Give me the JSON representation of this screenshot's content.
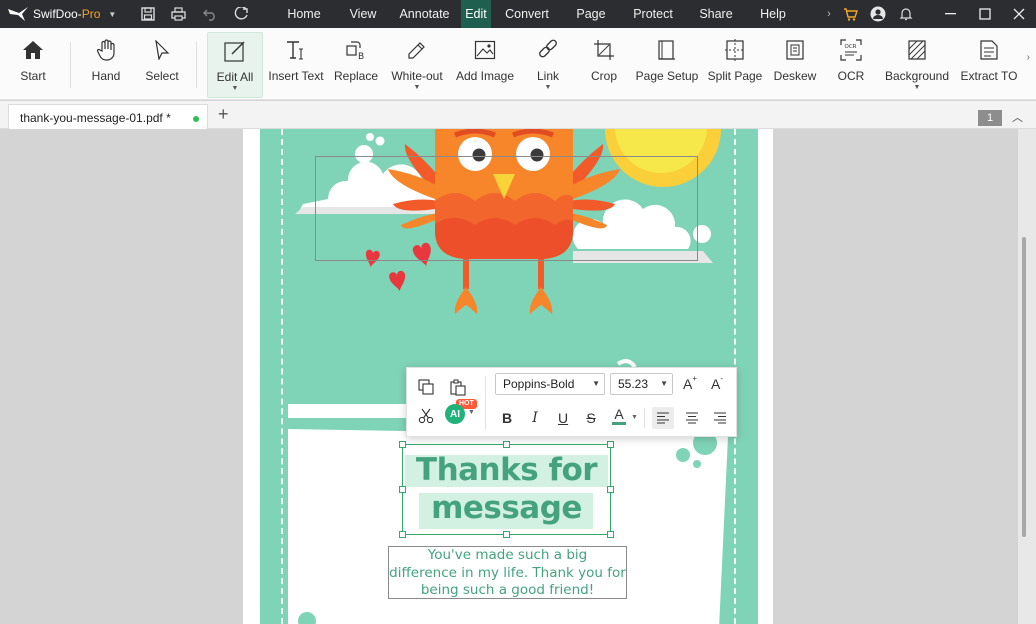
{
  "app": {
    "brand": "SwifDoo-",
    "brand_suffix": "Pro"
  },
  "menu": {
    "items": [
      {
        "label": "Home"
      },
      {
        "label": "View"
      },
      {
        "label": "Annotate"
      },
      {
        "label": "Edit"
      },
      {
        "label": "Convert"
      },
      {
        "label": "Page"
      },
      {
        "label": "Protect"
      },
      {
        "label": "Share"
      },
      {
        "label": "Help"
      }
    ],
    "active": "Edit"
  },
  "ribbon": {
    "tools": [
      {
        "label": "Start",
        "icon": "home-icon"
      },
      {
        "label": "Hand",
        "icon": "hand-icon"
      },
      {
        "label": "Select",
        "icon": "cursor-icon"
      },
      {
        "label": "Edit All",
        "icon": "edit-all-icon",
        "active": true,
        "dropdown": true
      },
      {
        "label": "Insert Text",
        "icon": "insert-text-icon"
      },
      {
        "label": "Replace",
        "icon": "replace-icon"
      },
      {
        "label": "White-out",
        "icon": "white-out-icon",
        "dropdown": true
      },
      {
        "label": "Add Image",
        "icon": "add-image-icon"
      },
      {
        "label": "Link",
        "icon": "link-icon",
        "dropdown": true
      },
      {
        "label": "Crop",
        "icon": "crop-icon"
      },
      {
        "label": "Page Setup",
        "icon": "page-setup-icon"
      },
      {
        "label": "Split Page",
        "icon": "split-page-icon"
      },
      {
        "label": "Deskew",
        "icon": "deskew-icon"
      },
      {
        "label": "OCR",
        "icon": "ocr-icon"
      },
      {
        "label": "Background",
        "icon": "background-icon",
        "dropdown": true
      },
      {
        "label": "Extract TO",
        "icon": "extract-toc-icon"
      }
    ]
  },
  "tabs": {
    "document": "thank-you-message-01.pdf *",
    "page_number": "1"
  },
  "document": {
    "title_line1": "Thanks for",
    "title_line2": "message",
    "body_line1": "You've made such a big",
    "body_line2": "difference in my life. Thank you for",
    "body_line3": "being such a good friend!"
  },
  "text_toolbar": {
    "font": "Poppins-Bold",
    "size": "55.23",
    "ai_label": "AI",
    "hot_label": "HOT",
    "bold": "B",
    "italic": "I",
    "underline": "U",
    "strike": "S",
    "color": "A"
  },
  "colors": {
    "accent": "#1f5f4f",
    "mint": "#7fd3b7",
    "title_green": "#44a37e",
    "owl_orange": "#f7852a",
    "heart_red": "#e8383d"
  }
}
